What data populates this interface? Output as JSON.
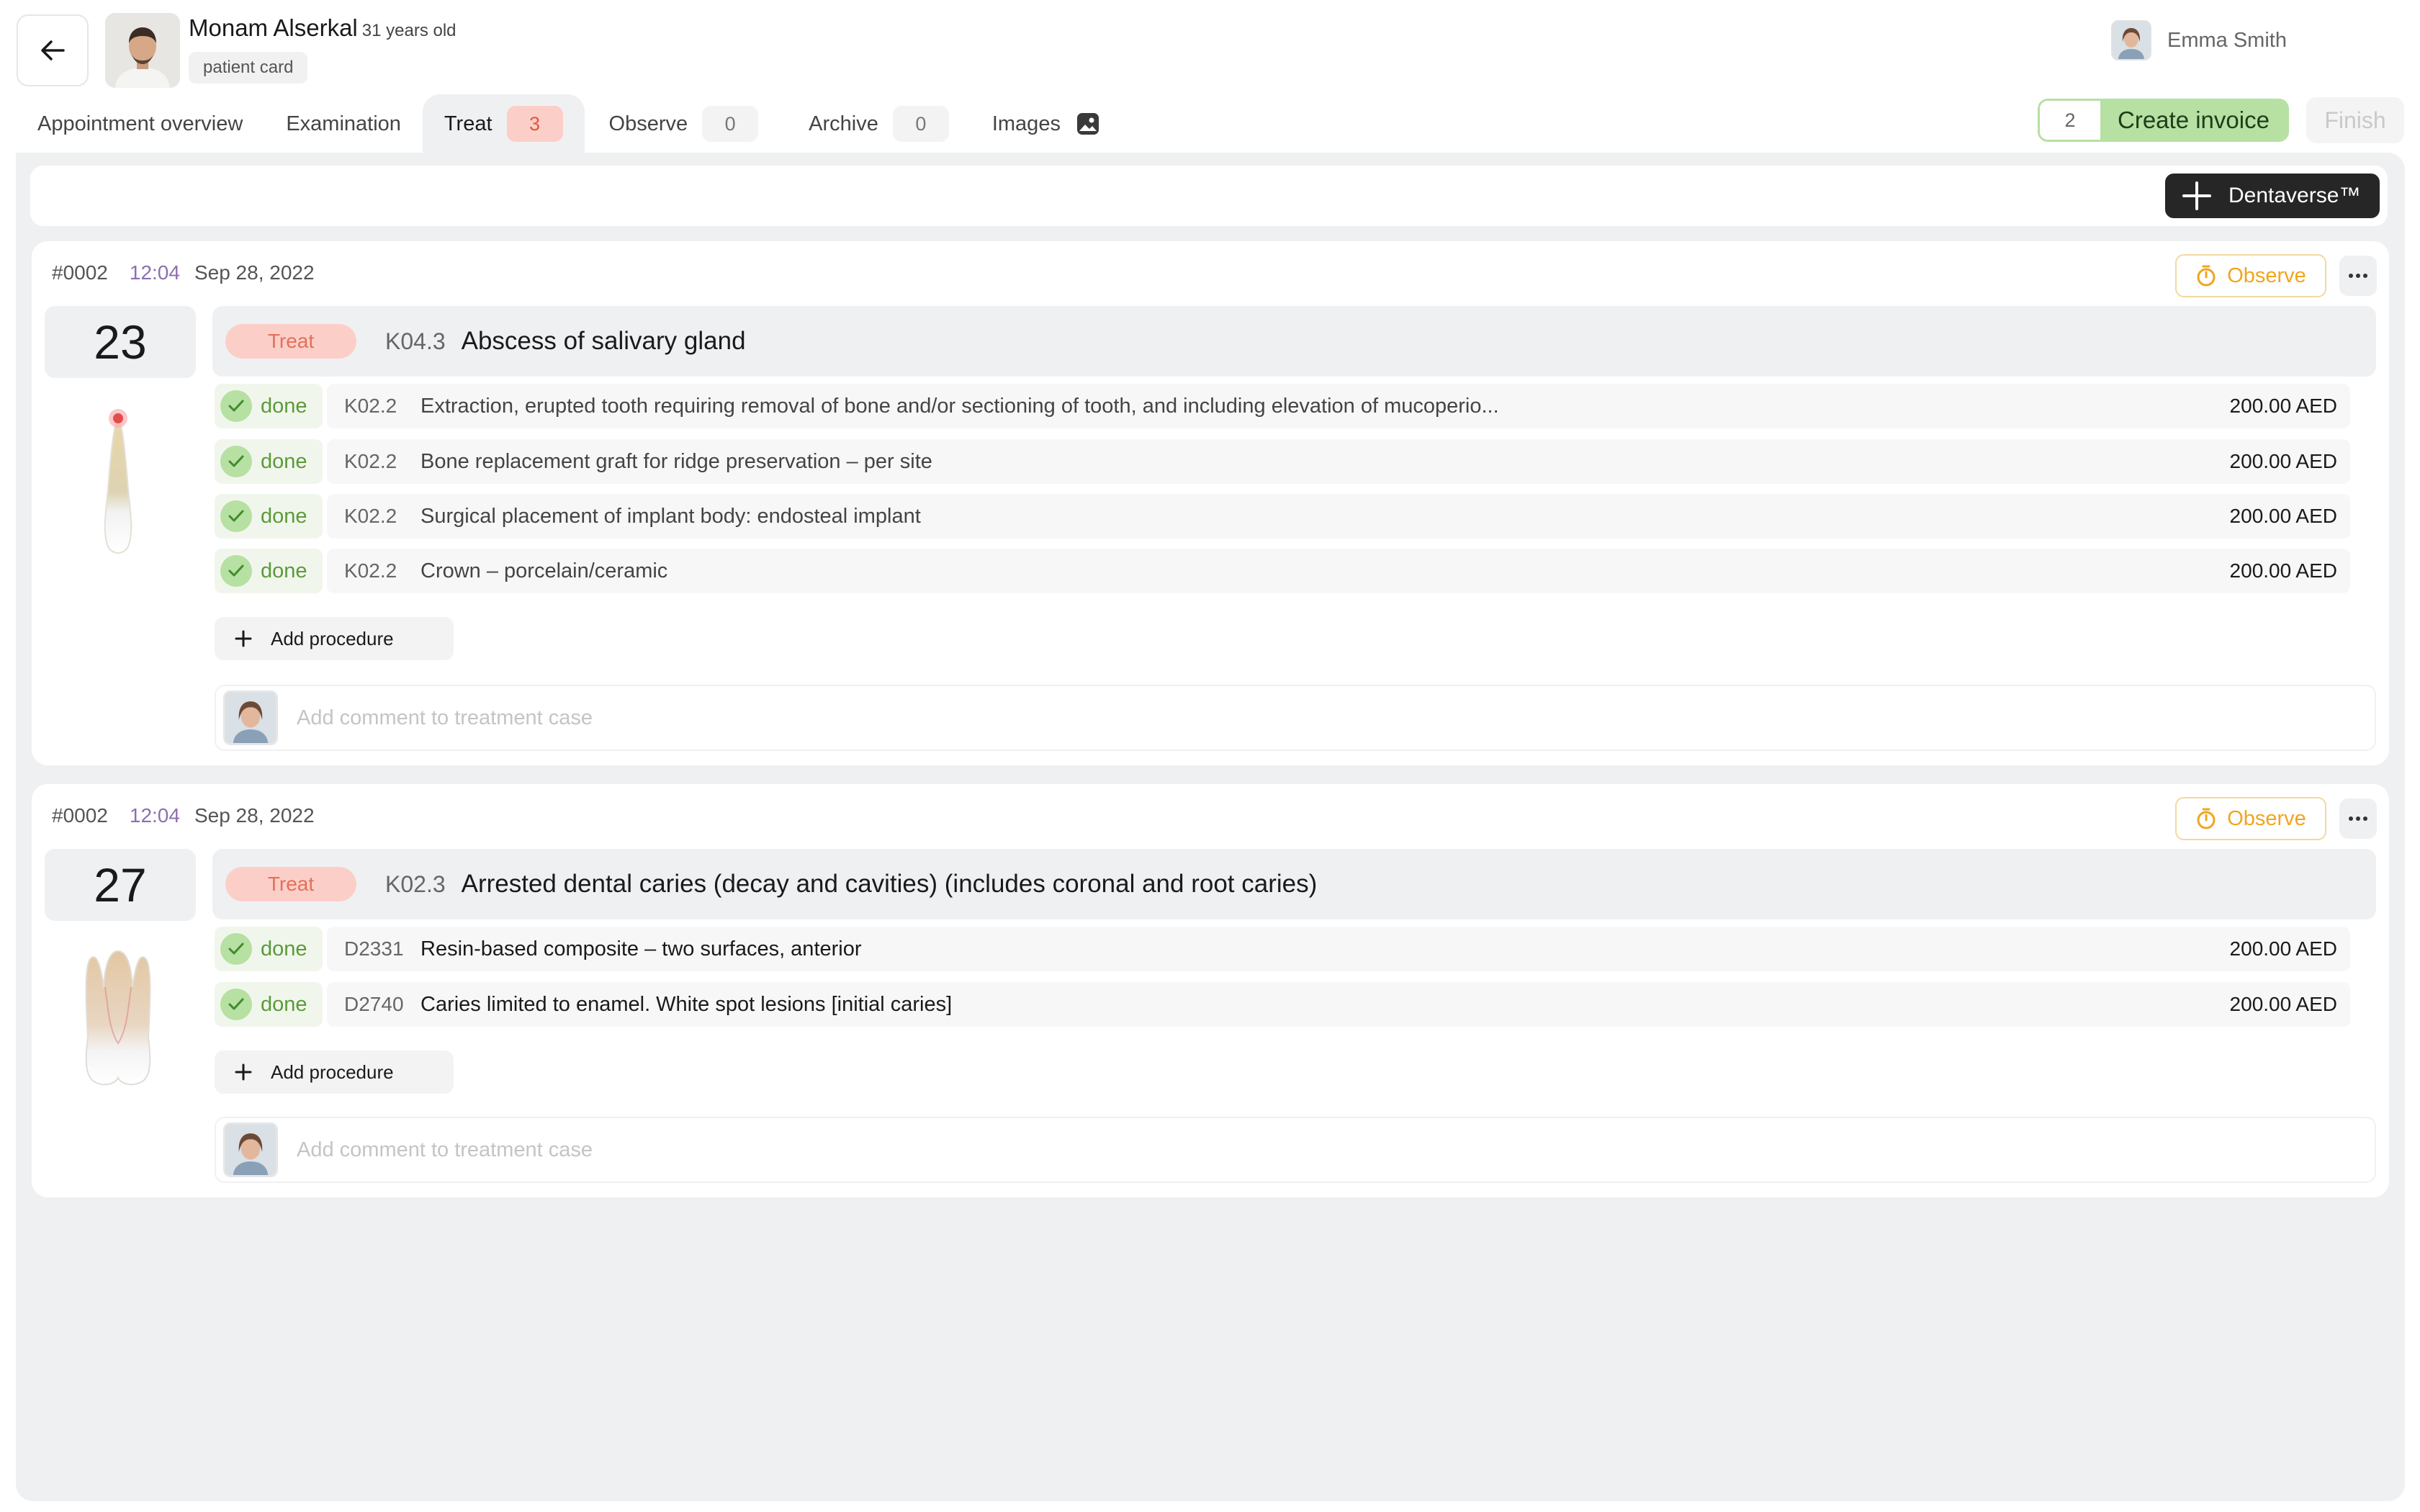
{
  "header": {
    "patient_name": "Monam Alserkal",
    "patient_age": "31 years old",
    "patient_card": "patient card",
    "user_name": "Emma Smith"
  },
  "tabs": [
    {
      "label": "Appointment overview"
    },
    {
      "label": "Examination"
    },
    {
      "label": "Treat",
      "count": "3"
    },
    {
      "label": "Observe",
      "count": "0"
    },
    {
      "label": "Archive",
      "count": "0"
    },
    {
      "label": "Images"
    }
  ],
  "actions": {
    "invoice_count": "2",
    "create_invoice": "Create invoice",
    "finish": "Finish",
    "dentaverse": "Dentaverse™"
  },
  "cases": [
    {
      "id": "#0002",
      "time": "12:04",
      "date": "Sep 28, 2022",
      "observe_label": "Observe",
      "tooth": "23",
      "status": "Treat",
      "diagnosis_code": "K04.3",
      "diagnosis": "Abscess of salivary gland",
      "procedures": [
        {
          "status": "done",
          "code": "K02.2",
          "description": "Extraction, erupted tooth requiring removal of bone and/or sectioning of tooth, and including elevation of mucoperio...",
          "price": "200.00 AED"
        },
        {
          "status": "done",
          "code": "K02.2",
          "description": "Bone replacement graft for ridge preservation – per site",
          "price": "200.00 AED"
        },
        {
          "status": "done",
          "code": "K02.2",
          "description": "Surgical placement of implant body: endosteal implant",
          "price": "200.00 AED"
        },
        {
          "status": "done",
          "code": "K02.2",
          "description": "Crown – porcelain/ceramic",
          "price": "200.00 AED"
        }
      ],
      "add_procedure": "Add procedure",
      "comment_placeholder": "Add comment to treatment case"
    },
    {
      "id": "#0002",
      "time": "12:04",
      "date": "Sep 28, 2022",
      "observe_label": "Observe",
      "tooth": "27",
      "status": "Treat",
      "diagnosis_code": "K02.3",
      "diagnosis": "Arrested dental caries (decay and cavities) (includes coronal and root caries)",
      "procedures": [
        {
          "status": "done",
          "code": "D2331",
          "description": "Resin-based composite – two surfaces, anterior",
          "price": "200.00 AED"
        },
        {
          "status": "done",
          "code": "D2740",
          "description": "Caries limited to enamel. White spot lesions [initial caries]",
          "price": "200.00 AED"
        }
      ],
      "add_procedure": "Add procedure",
      "comment_placeholder": "Add comment to treatment case"
    }
  ]
}
